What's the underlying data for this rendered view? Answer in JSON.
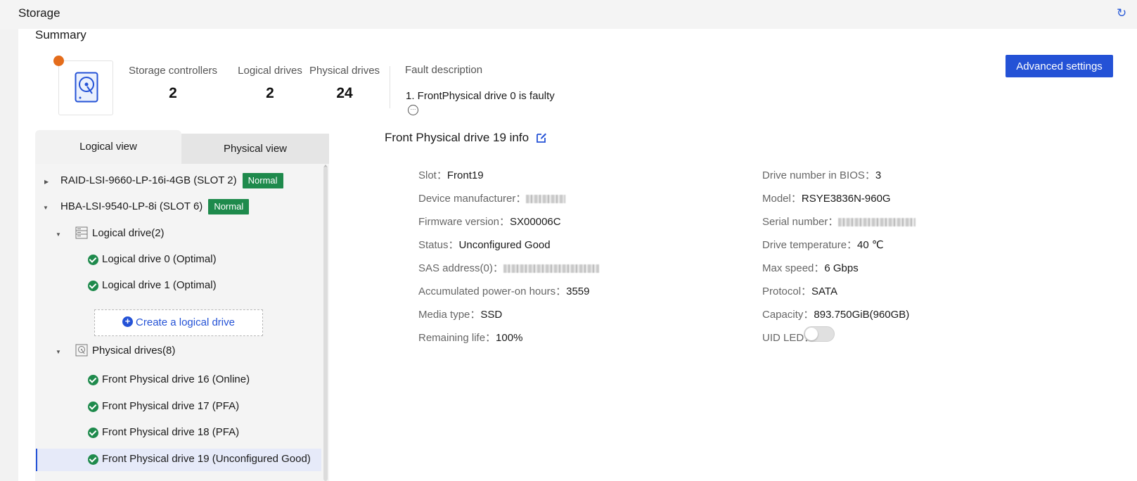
{
  "header": {
    "title": "Storage",
    "refresh_icon": "refresh-icon"
  },
  "summary": {
    "title": "Summary",
    "stats": [
      {
        "label": "Storage controllers",
        "value": "2"
      },
      {
        "label": "Logical drives",
        "value": "2"
      },
      {
        "label": "Physical drives",
        "value": "24"
      }
    ],
    "fault_label": "Fault description",
    "fault_item": "1. FrontPhysical drive 0 is faulty",
    "more_icon": "···",
    "alert_color": "#e46c1b",
    "advanced_button": "Advanced settings"
  },
  "tabs": {
    "logical": "Logical view",
    "physical": "Physical view"
  },
  "tree": {
    "controllers": [
      {
        "label": "RAID-LSI-9660-LP-16i-4GB (SLOT 2)",
        "badge": "Normal"
      },
      {
        "label": "HBA-LSI-9540-LP-8i (SLOT 6)",
        "badge": "Normal"
      }
    ],
    "logical_group": "Logical drive(2)",
    "logical_items": [
      "Logical drive 0 (Optimal)",
      "Logical drive 1 (Optimal)"
    ],
    "create_label": "Create a logical drive",
    "physical_group": "Physical drives(8)",
    "physical_items": [
      "Front Physical drive 16 (Online)",
      "Front Physical drive 17 (PFA)",
      "Front Physical drive 18 (PFA)",
      "Front Physical drive 19 (Unconfigured Good)"
    ],
    "status_color": "#1e8a4c"
  },
  "info": {
    "title": "Front Physical drive 19 info",
    "left": [
      {
        "key": "Slot：",
        "value": "Front19"
      },
      {
        "key": "Device manufacturer：",
        "value": ""
      },
      {
        "key": "Firmware version：",
        "value": "SX00006C"
      },
      {
        "key": "Status：",
        "value": "Unconfigured Good"
      },
      {
        "key": "SAS address(0)：",
        "value": ""
      },
      {
        "key": "Accumulated power-on hours：",
        "value": "3559"
      },
      {
        "key": "Media type：",
        "value": "SSD"
      },
      {
        "key": "Remaining life：",
        "value": "100%"
      }
    ],
    "right": [
      {
        "key": "Drive number in BIOS：",
        "value": "3"
      },
      {
        "key": "Model：",
        "value": "RSYE3836N-960G"
      },
      {
        "key": "Serial number：",
        "value": ""
      },
      {
        "key": "Drive temperature：",
        "value": "40 ℃"
      },
      {
        "key": "Max speed：",
        "value": "6 Gbps"
      },
      {
        "key": "Protocol：",
        "value": "SATA"
      },
      {
        "key": "Capacity：",
        "value": "893.750GiB(960GB)"
      },
      {
        "key": "UID LED：",
        "value": ""
      }
    ],
    "uid_led_on": false,
    "accent_color": "#2452d6"
  }
}
